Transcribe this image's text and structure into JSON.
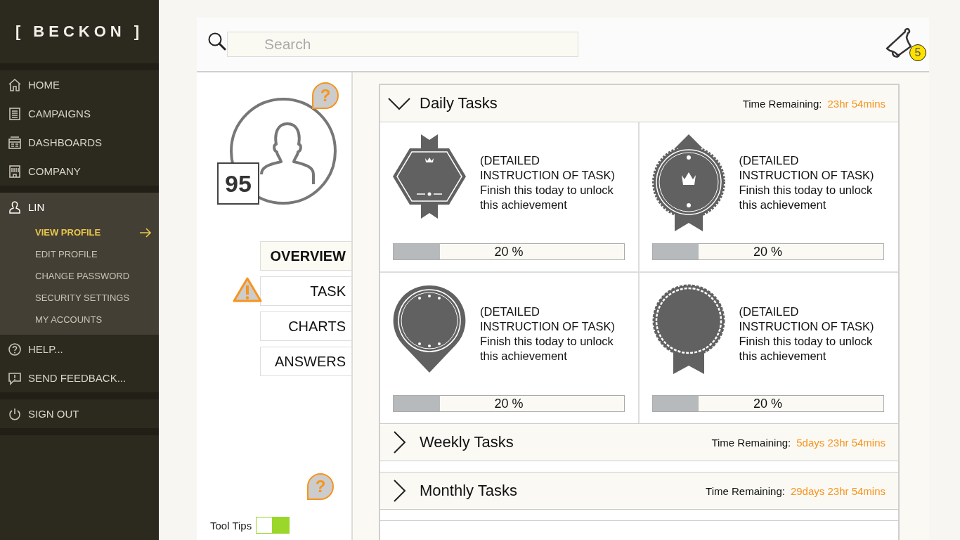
{
  "sidebar": {
    "logo": "[ BECKON ]",
    "nav": [
      {
        "label": "HOME"
      },
      {
        "label": "CAMPAIGNS"
      },
      {
        "label": "DASHBOARDS"
      },
      {
        "label": "COMPANY"
      }
    ],
    "user": {
      "label": "LIN",
      "items": [
        {
          "label": "VIEW PROFILE",
          "selected": true
        },
        {
          "label": "EDIT PROFILE",
          "selected": false
        },
        {
          "label": "CHANGE PASSWORD",
          "selected": false
        },
        {
          "label": "SECURITY SETTINGS",
          "selected": false
        },
        {
          "label": "MY ACCOUNTS",
          "selected": false
        }
      ]
    },
    "extra": [
      {
        "label": "HELP..."
      },
      {
        "label": "SEND FEEDBACK..."
      }
    ],
    "sign_out": {
      "label": "SIGN OUT"
    }
  },
  "search": {
    "placeholder": "Search"
  },
  "notifications": {
    "count": "5"
  },
  "profile": {
    "score": "95",
    "help_badge": "?",
    "tabs": [
      {
        "label": "OVERVIEW",
        "selected": true,
        "warning": false
      },
      {
        "label": "TASK",
        "selected": false,
        "warning": true
      },
      {
        "label": "CHARTS",
        "selected": false,
        "warning": false
      },
      {
        "label": "ANSWERS",
        "selected": false,
        "warning": false
      }
    ],
    "tool_tips": {
      "label": "Tool Tips",
      "on": true,
      "help_badge": "?"
    }
  },
  "task_groups": [
    {
      "title": "Daily Tasks",
      "expanded": true,
      "time_label": "Time Remaining:",
      "time": "23hr 54mins",
      "tasks": [
        {
          "kind": "hexagon",
          "text_1": "(DETAILED",
          "text_2": "INSTRUCTION OF TASK)",
          "text_3": "Finish this today to unlock",
          "text_4": "this achievement",
          "level": 0.2,
          "reading": "20 %"
        },
        {
          "kind": "rosette",
          "text_1": "(DETAILED",
          "text_2": "INSTRUCTION OF TASK)",
          "text_3": "Finish this today to unlock",
          "text_4": "this achievement",
          "level": 0.2,
          "reading": "20 %"
        },
        {
          "kind": "pin",
          "text_1": "(DETAILED",
          "text_2": "INSTRUCTION OF TASK)",
          "text_3": "Finish this today to unlock",
          "text_4": "this achievement",
          "level": 0.2,
          "reading": "20 %"
        },
        {
          "kind": "seal",
          "text_1": "(DETAILED",
          "text_2": "INSTRUCTION OF TASK)",
          "text_3": "Finish this today to unlock",
          "text_4": "this achievement",
          "level": 0.2,
          "reading": "20 %"
        }
      ]
    },
    {
      "title": "Weekly Tasks",
      "expanded": false,
      "time_label": "Time Remaining:",
      "time": "5days 23hr 54mins"
    },
    {
      "title": "Monthly Tasks",
      "expanded": false,
      "time_label": "Time Remaining:",
      "time": "29days 23hr 54mins"
    }
  ]
}
